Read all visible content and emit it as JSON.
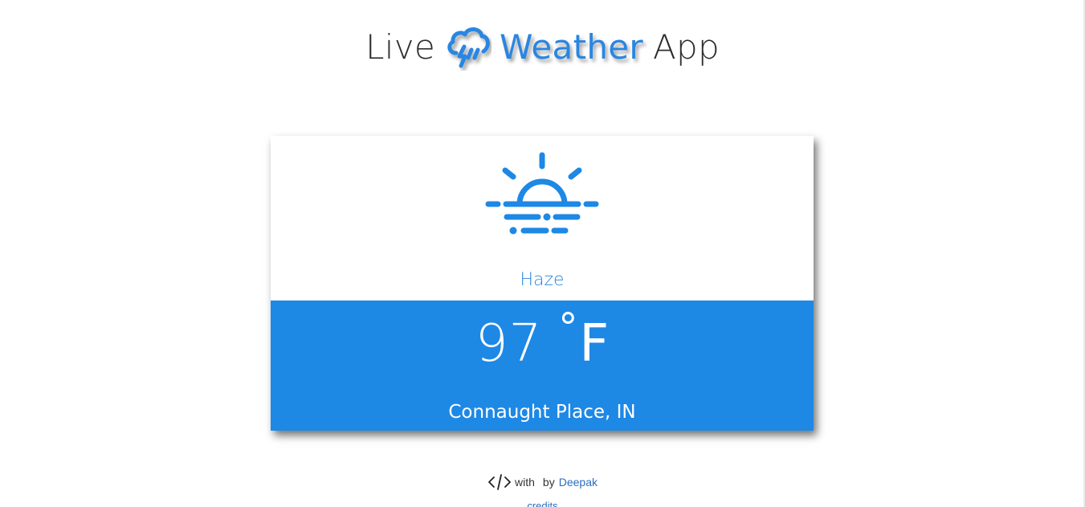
{
  "header": {
    "title_part_1": "Live",
    "title_part_2": "Weather",
    "title_part_3": "App",
    "logo_icon": "cloud-rain-lightning-icon"
  },
  "weather": {
    "icon": "haze-sun-icon",
    "condition": "Haze",
    "temperature": "97",
    "degree_symbol": "°",
    "unit": "F",
    "location": "Connaught Place, IN"
  },
  "footer": {
    "code_icon": "code-icon",
    "with_text": "with",
    "by_text": "by",
    "author": "Deepak",
    "credits": "credits"
  },
  "colors": {
    "accent": "#1e88e5",
    "title_blue": "#2a86e0",
    "link": "#2a6ebd",
    "text_dark": "#2d2d2d"
  }
}
